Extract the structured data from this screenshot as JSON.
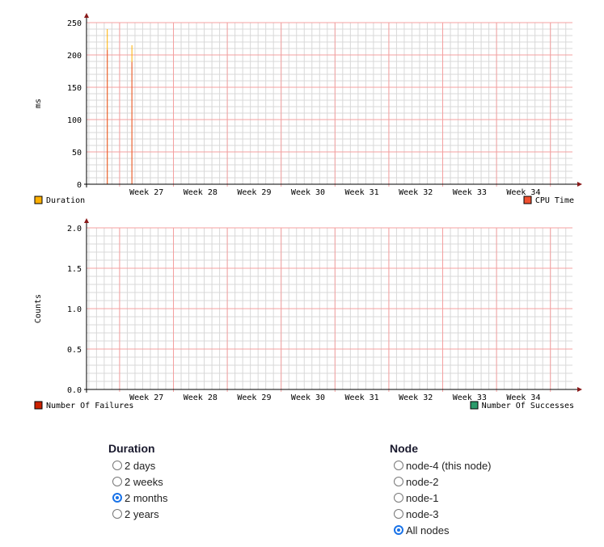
{
  "chart_data": [
    {
      "type": "bar",
      "ylabel": "ms",
      "ylim": [
        0,
        250
      ],
      "yticks": [
        0,
        50,
        100,
        150,
        200,
        250
      ],
      "ymajor": 50,
      "yminor": 10,
      "xlabels": [
        "Week 27",
        "Week 28",
        "Week 29",
        "Week 30",
        "Week 31",
        "Week 32",
        "Week 33",
        "Week 34"
      ],
      "days_total": 63,
      "first_week_start_day": 4.3,
      "legend": [
        {
          "name": "Duration",
          "color": "#ffb000",
          "position": "bottom-left"
        },
        {
          "name": "CPU Time",
          "color": "#f05030",
          "position": "bottom-right"
        }
      ],
      "series": [
        {
          "name": "Duration",
          "color": "#ffb000",
          "points": [
            {
              "day": 2.7,
              "value": 240
            },
            {
              "day": 5.9,
              "value": 215
            }
          ]
        },
        {
          "name": "CPU Time",
          "color": "#e8553c",
          "points": [
            {
              "day": 2.7,
              "value": 208
            },
            {
              "day": 5.9,
              "value": 189
            }
          ]
        }
      ]
    },
    {
      "type": "bar",
      "ylabel": "Counts",
      "ylim": [
        0,
        2
      ],
      "yticks": [
        "0.0",
        "0.5",
        "1.0",
        "1.5",
        "2.0"
      ],
      "ymajor": 0.5,
      "yminor": 0.1,
      "xlabels": [
        "Week 27",
        "Week 28",
        "Week 29",
        "Week 30",
        "Week 31",
        "Week 32",
        "Week 33",
        "Week 34"
      ],
      "days_total": 63,
      "first_week_start_day": 4.3,
      "legend": [
        {
          "name": "Number Of Failures",
          "color": "#cc2200",
          "position": "bottom-left"
        },
        {
          "name": "Number Of Successes",
          "color": "#2a9a6a",
          "position": "bottom-right"
        }
      ],
      "series": [
        {
          "name": "Number Of Failures",
          "points": []
        },
        {
          "name": "Number Of Successes",
          "points": []
        }
      ]
    }
  ],
  "controls": {
    "duration": {
      "title": "Duration",
      "options": [
        "2 days",
        "2 weeks",
        "2 months",
        "2 years"
      ],
      "selected": 2
    },
    "node": {
      "title": "Node",
      "options": [
        "node-4 (this node)",
        "node-2",
        "node-1",
        "node-3",
        "All nodes"
      ],
      "selected": 4
    }
  }
}
